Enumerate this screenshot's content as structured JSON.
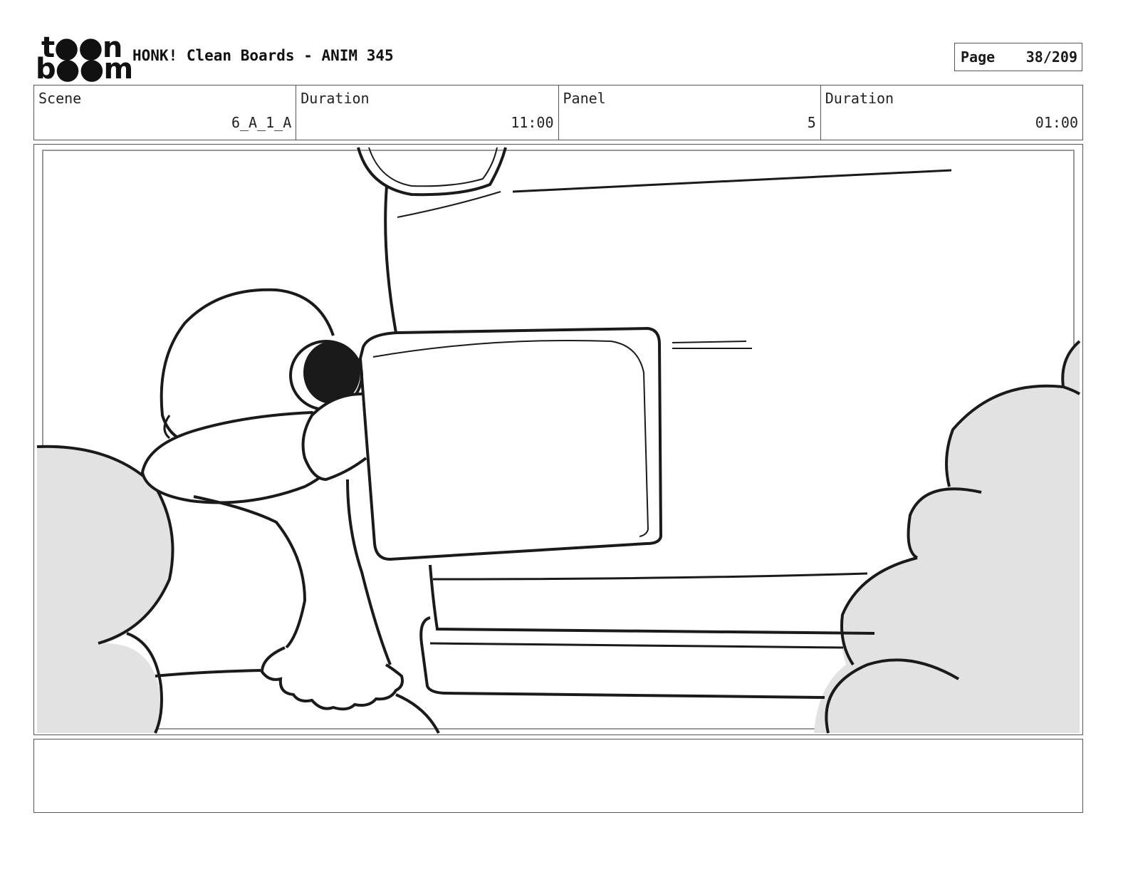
{
  "logo": {
    "line1": "t●●n",
    "line2": "b●●m"
  },
  "header": {
    "title": "HONK! Clean Boards - ANIM 345",
    "page_label": "Page",
    "page_value": "38/209"
  },
  "info": [
    {
      "label": "Scene",
      "value": "6_A_1_A"
    },
    {
      "label": "Duration",
      "value": "11:00"
    },
    {
      "label": "Panel",
      "value": "5"
    },
    {
      "label": "Duration",
      "value": "01:00"
    }
  ],
  "notes": {
    "text": ""
  },
  "colors": {
    "line": "#1a1a1a",
    "shade": "#e2e2e2",
    "border": "#555555"
  }
}
